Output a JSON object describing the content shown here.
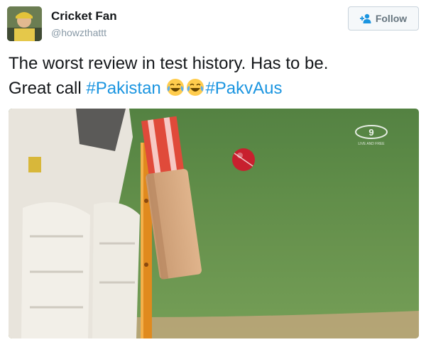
{
  "user": {
    "name": "Cricket Fan",
    "handle": "@howzthattt"
  },
  "follow_button": {
    "label": "Follow",
    "icon": "add-user-icon"
  },
  "tweet": {
    "line1": "The worst review in test history. Has to be.",
    "line2_prefix": "Great call ",
    "hashtag1": "#Pakistan",
    "emoji": "face-with-tears-of-joy",
    "hashtag2": "#PakvAus"
  },
  "media": {
    "broadcaster_logo_text": "9",
    "broadcaster_tagline": "LIVE AND FREE"
  },
  "colors": {
    "link": "#1b95e0",
    "text": "#14171a",
    "muted": "#8899a6"
  }
}
